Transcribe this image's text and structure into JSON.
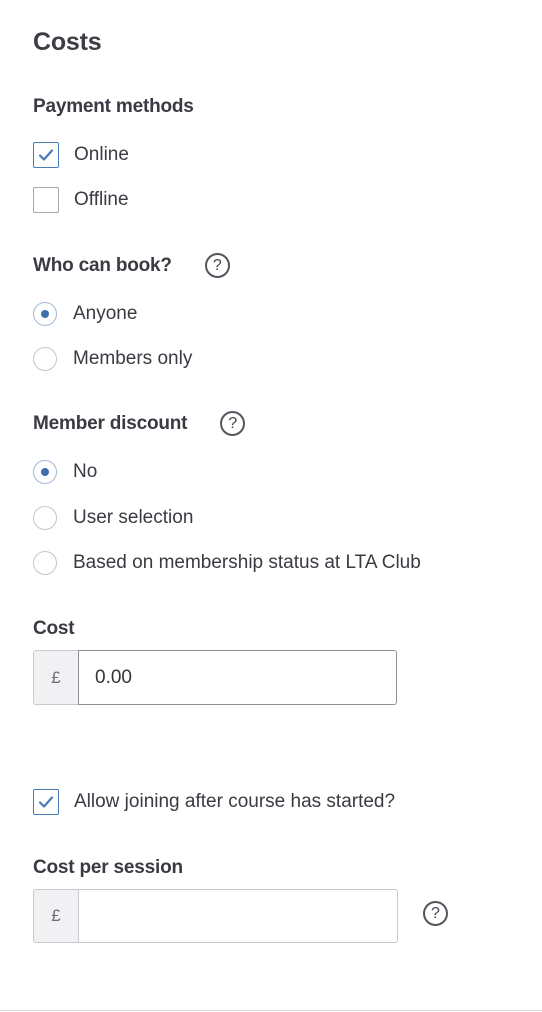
{
  "section_title": "Costs",
  "payment_methods": {
    "label": "Payment methods",
    "options": [
      {
        "label": "Online",
        "checked": true
      },
      {
        "label": "Offline",
        "checked": false
      }
    ]
  },
  "who_can_book": {
    "label": "Who can book?",
    "help_glyph": "?",
    "options": [
      {
        "label": "Anyone",
        "selected": true
      },
      {
        "label": "Members only",
        "selected": false
      }
    ]
  },
  "member_discount": {
    "label": "Member discount",
    "help_glyph": "?",
    "options": [
      {
        "label": "No",
        "selected": true
      },
      {
        "label": "User selection",
        "selected": false
      },
      {
        "label": "Based on membership status at LTA Club",
        "selected": false
      }
    ]
  },
  "cost": {
    "label": "Cost",
    "currency": "£",
    "value": "0.00"
  },
  "allow_joining": {
    "label": "Allow joining after course has started?",
    "checked": true
  },
  "cost_per_session": {
    "label": "Cost per session",
    "currency": "£",
    "value": "",
    "help_glyph": "?"
  },
  "colors": {
    "accent": "#3e6ea8",
    "text": "#3a3a42",
    "border": "#c9c9cf"
  }
}
